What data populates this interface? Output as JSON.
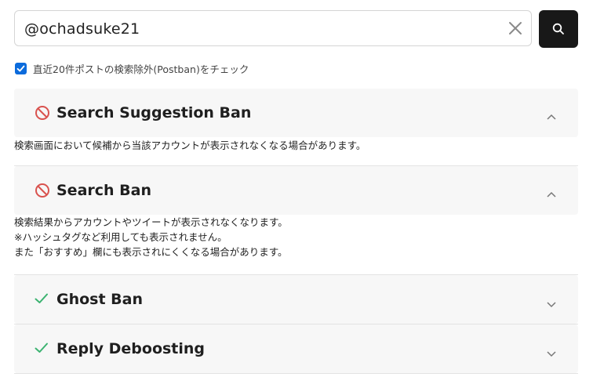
{
  "search": {
    "value": "@ochadsuke21",
    "clear_icon": "close-icon",
    "button_icon": "search-icon"
  },
  "options": {
    "postban_checked": true,
    "postban_label": "直近20件ポストの検索除外(Postban)をチェック"
  },
  "results": [
    {
      "title": "Search Suggestion Ban",
      "status": "banned",
      "status_icon": "prohibited-icon",
      "expanded": true,
      "description": [
        "検索画面において候補から当該アカウントが表示されなくなる場合があります。"
      ]
    },
    {
      "title": "Search Ban",
      "status": "banned",
      "status_icon": "prohibited-icon",
      "expanded": true,
      "description": [
        "検索結果からアカウントやツイートが表示されなくなります。",
        "※ハッシュタグなど利用しても表示されません。",
        "また「おすすめ」欄にも表示されにくくなる場合があります。"
      ]
    },
    {
      "title": "Ghost Ban",
      "status": "ok",
      "status_icon": "check-icon",
      "expanded": false,
      "description": []
    },
    {
      "title": "Reply Deboosting",
      "status": "ok",
      "status_icon": "check-icon",
      "expanded": false,
      "description": []
    }
  ],
  "colors": {
    "banned": "#d9534f",
    "ok": "#3cb371",
    "accent": "#0b6bdc",
    "button": "#181818"
  }
}
